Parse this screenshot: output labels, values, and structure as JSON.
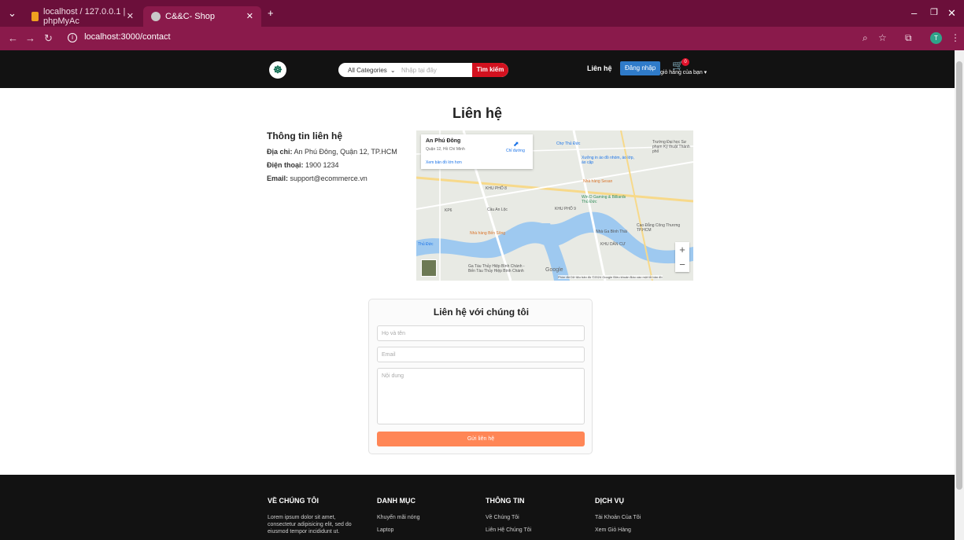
{
  "browser": {
    "tabs": [
      {
        "title": "localhost / 127.0.0.1 | phpMyAc"
      },
      {
        "title": "C&&C- Shop"
      }
    ],
    "url": "localhost:3000/contact"
  },
  "header": {
    "search": {
      "category_label": "All Categories",
      "placeholder": "Nhập tại đây",
      "button_label": "Tìm kiếm"
    },
    "nav_contact": "Liên hệ",
    "login_label": "Đăng nhập",
    "cart_count": "0",
    "cart_label": "giỏ hàng của bạn"
  },
  "page": {
    "title": "Liên hệ",
    "info": {
      "heading": "Thông tin liên hệ",
      "address_label": "Địa chỉ:",
      "address_value": "An Phú Đông, Quận 12, TP.HCM",
      "phone_label": "Điện thoại:",
      "phone_value": "1900 1234",
      "email_label": "Email:",
      "email_value": "support@ecommerce.vn"
    },
    "map": {
      "card_title": "An Phú Đông",
      "card_subtitle": "Quận 12, Hồ Chí Minh",
      "card_link": "Xem bản đồ lớn hơn",
      "directions": "Chỉ đường",
      "zoom_in": "+",
      "zoom_out": "−",
      "google": "Google",
      "attribution": "Phím tắt   Dữ liệu bản đồ ©2024 Google   Điều khoản   Báo cáo một lỗi bản đồ",
      "labels": {
        "cho_thu_duc": "Chợ Thủ Đức",
        "khu_pho_8": "KHU PHỐ 8",
        "khu_pho_9": "KHU PHỐ 9",
        "kp6": "KP6",
        "cau_an_loc": "Cầu An Lộc",
        "nha_hang_sesan": "Nhà hàng Sesan",
        "win_gaming": "Win D Gaming & Billiards Thủ Đức",
        "nha_hang_ben_song": "Nhà hàng Bến Sông",
        "ga_tau": "Ga Tàu Thủy Hiệp Bình Chánh - Bến Tàu Thủy Hiệp Bình Chánh",
        "nha_ga_binh_thai": "Nhà Ga Bình Thái",
        "cao_dang": "Cao Đẳng Công Thương TP.HCM",
        "truong_dai_hoc": "Trường Đại học Sư phạm Kỹ thuật Thành phố",
        "khu_dan_cu": "KHU DÂN CƯ",
        "thu_duc": "Thủ Đức",
        "xuong_in": "Xưởng in áo đồ nhóm, áo lớp, áo cặp"
      }
    },
    "form": {
      "title": "Liên hệ với chúng tôi",
      "name_placeholder": "Họ và tên",
      "email_placeholder": "Email",
      "message_placeholder": "Nội dung",
      "submit_label": "Gửi liên hệ"
    }
  },
  "footer": {
    "about": {
      "title": "VỀ CHÚNG TÔI",
      "text": "Lorem ipsum dolor sit amet, consectetur adipisicing elit, sed do eiusmod tempor incididunt ut."
    },
    "categories": {
      "title": "DANH MỤC",
      "items": [
        "Khuyến mãi nóng",
        "Laptop"
      ]
    },
    "info": {
      "title": "THÔNG TIN",
      "items": [
        "Về Chúng Tôi",
        "Liên Hệ Chúng Tôi"
      ]
    },
    "services": {
      "title": "DỊCH VỤ",
      "items": [
        "Tài Khoản Của Tôi",
        "Xem Giỏ Hàng"
      ]
    }
  }
}
